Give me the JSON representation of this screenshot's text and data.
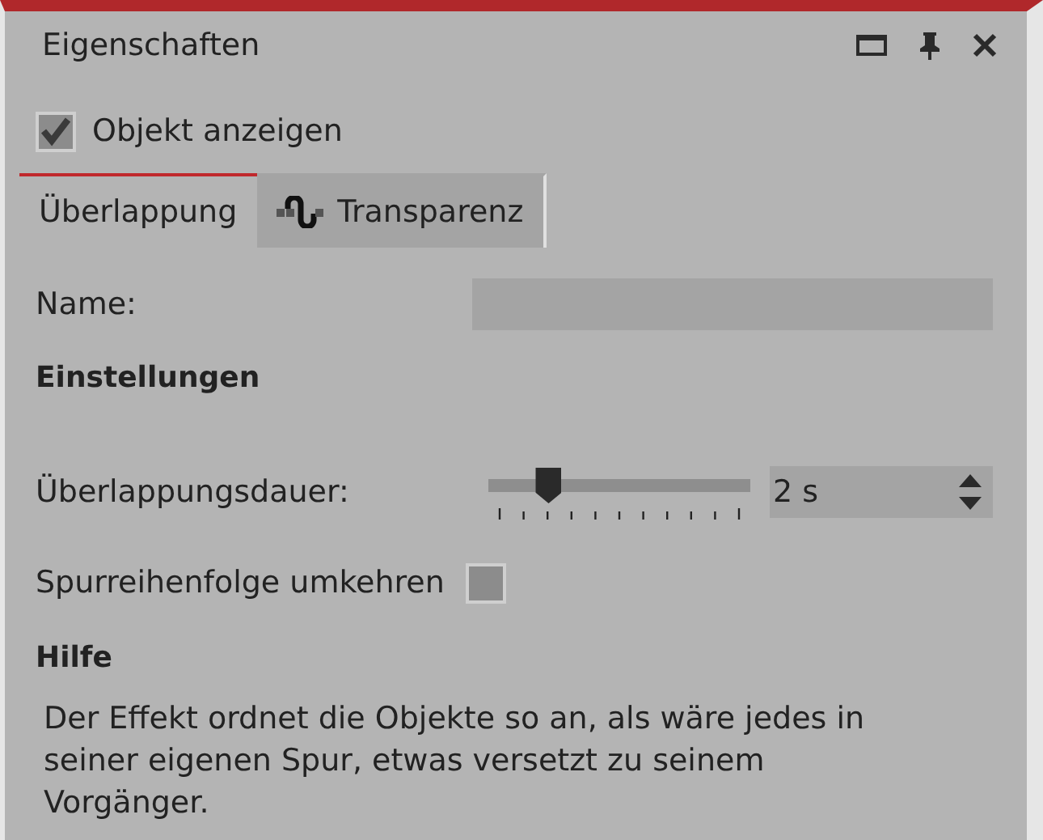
{
  "panel": {
    "title": "Eigenschaften"
  },
  "show_object": {
    "label": "Objekt anzeigen",
    "checked": true
  },
  "tabs": [
    {
      "label": "Überlappung",
      "selected": true,
      "icon": false
    },
    {
      "label": "Transparenz",
      "selected": false,
      "icon": true
    }
  ],
  "name_field": {
    "label": "Name:"
  },
  "settings_heading": "Einstellungen",
  "duration": {
    "label": "Überlappungsdauer:",
    "level": 0.23,
    "value": "2 s"
  },
  "reverse": {
    "label": "Spurreihenfolge umkehren",
    "checked": false
  },
  "help": {
    "heading": "Hilfe",
    "text": "Der Effekt ordnet die Objekte so an, als wäre jedes in seiner eigenen Spur, etwas versetzt zu seinem Vorgänger."
  }
}
